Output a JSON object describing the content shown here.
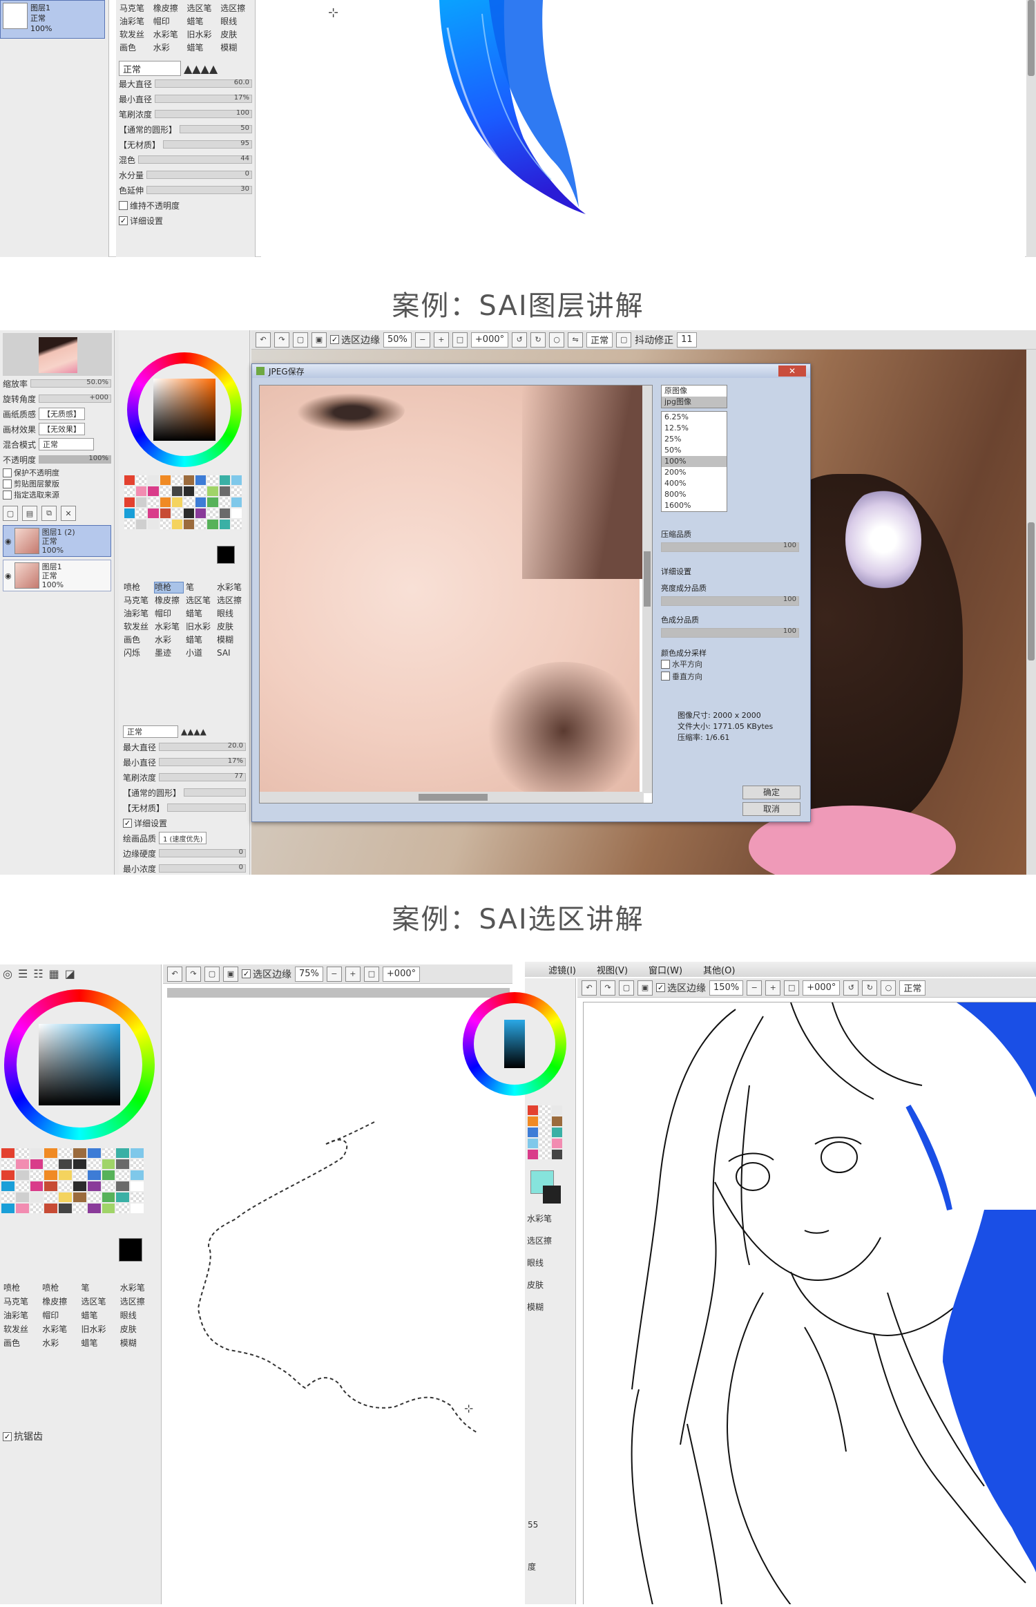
{
  "top_panel": {
    "layer_label": "图层1",
    "layer_mode": "正常",
    "layer_opacity": "100%",
    "tools": [
      [
        "马克笔",
        "橡皮擦",
        "选区笔",
        "选区擦"
      ],
      [
        "油彩笔",
        "帽印",
        "蜡笔",
        "眼线"
      ],
      [
        "软发丝",
        "水彩笔",
        "旧水彩",
        "皮肤"
      ],
      [
        "画色",
        "水彩",
        "蜡笔",
        "模糊"
      ]
    ],
    "blend_mode": "正常",
    "rows": [
      {
        "label": "最大直径",
        "value": "60.0"
      },
      {
        "label": "最小直径",
        "value": "17%"
      },
      {
        "label": "笔刷浓度",
        "value": "100"
      },
      {
        "label": "【通常的圆形】",
        "value": "50"
      },
      {
        "label": "【无材质】",
        "value": "95"
      },
      {
        "label": "混色",
        "value": "44"
      },
      {
        "label": "水分量",
        "value": "0"
      },
      {
        "label": "色延伸",
        "value": "30"
      }
    ],
    "keep_opacity": "维持不透明度",
    "detail_settings": "详细设置"
  },
  "caption1": "案例：SAI图层讲解",
  "caption2": "案例：SAI选区讲解",
  "mid": {
    "toolbar": {
      "selection_edge": "选区边缘",
      "zoom": "50%",
      "angle": "+000°",
      "mode": "正常",
      "stabilizer_label": "抖动修正",
      "stabilizer": "11"
    },
    "left_panel": {
      "rows": [
        {
          "label": "缩放率",
          "value": "50.0%"
        },
        {
          "label": "旋转角度",
          "value": "+000"
        }
      ],
      "paper_texture": "画纸质感",
      "paper_texture_value": "【无质感】",
      "paper_effect": "画材效果",
      "paper_effect_value": "【无效果】",
      "blend_label": "混合模式",
      "blend_value": "正常",
      "opacity_label": "不透明度",
      "opacity_value": "100%",
      "options": [
        "保护不透明度",
        "剪贴图层蒙版",
        "指定选取来源"
      ],
      "layers": [
        {
          "name": "图层1 (2)",
          "mode": "正常",
          "opacity": "100%"
        },
        {
          "name": "图层1",
          "mode": "正常",
          "opacity": "100%"
        }
      ]
    },
    "tool_panel": {
      "tools": [
        [
          "喷枪",
          "喷枪",
          "笔",
          "水彩笔"
        ],
        [
          "马克笔",
          "橡皮擦",
          "选区笔",
          "选区擦"
        ],
        [
          "油彩笔",
          "帽印",
          "蜡笔",
          "眼线"
        ],
        [
          "软发丝",
          "水彩笔",
          "旧水彩",
          "皮肤"
        ],
        [
          "画色",
          "水彩",
          "蜡笔",
          "模糊"
        ],
        [
          "闪烁",
          "墨迹",
          "小道",
          "SAI"
        ]
      ],
      "blend_mode": "正常",
      "rows": [
        {
          "label": "最大直径",
          "value": "20.0"
        },
        {
          "label": "最小直径",
          "value": "17%"
        },
        {
          "label": "笔刷浓度",
          "value": "77"
        },
        {
          "label": "【通常的圆形】",
          "value": ""
        },
        {
          "label": "【无材质】",
          "value": ""
        }
      ],
      "detail_settings": "详细设置",
      "quality_label": "绘画品质",
      "quality_value": "1 (速度优先)",
      "edge_hardness": "边缘硬度",
      "edge_value": "0",
      "min_density": "最小浓度",
      "min_density_value": "0"
    },
    "dialog": {
      "title": "JPEG保存",
      "view_options": [
        "原图像",
        "jpg图像"
      ],
      "zoom_levels": [
        "6.25%",
        "12.5%",
        "25%",
        "50%",
        "100%",
        "200%",
        "400%",
        "800%",
        "1600%"
      ],
      "selected_zoom": "100%",
      "quality_label": "压缩品质",
      "quality_value": "100",
      "detail_label": "详细设置",
      "luma_label": "亮度成分品质",
      "luma_value": "100",
      "chroma_label": "色成分品质",
      "chroma_value": "100",
      "subsample_label": "颜色成分采样",
      "horizontal": "水平方向",
      "vertical": "垂直方向",
      "size_label": "图像尺寸:",
      "size_value": "2000 x 2000",
      "file_label": "文件大小:",
      "file_value": "1771.05 KBytes",
      "ratio_label": "压缩率:",
      "ratio_value": "1/6.61",
      "ok": "确定",
      "cancel": "取消"
    }
  },
  "bottom_left": {
    "toolbar": {
      "selection_edge": "选区边缘",
      "zoom": "75%",
      "angle": "+000°"
    },
    "tools": [
      [
        "喷枪",
        "喷枪",
        "笔",
        "水彩笔"
      ],
      [
        "马克笔",
        "橡皮擦",
        "选区笔",
        "选区擦"
      ],
      [
        "油彩笔",
        "帽印",
        "蜡笔",
        "眼线"
      ],
      [
        "软发丝",
        "水彩笔",
        "旧水彩",
        "皮肤"
      ],
      [
        "画色",
        "水彩",
        "蜡笔",
        "模糊"
      ]
    ],
    "antialias": "抗锯齿"
  },
  "bottom_right": {
    "menu": [
      "滤镜(I)",
      "视图(V)",
      "窗口(W)",
      "其他(O)"
    ],
    "toolbar": {
      "selection_edge": "选区边缘",
      "zoom": "150%",
      "angle": "+000°",
      "mode": "正常"
    },
    "tools": [
      "水彩笔",
      "选区擦",
      "眼线",
      "皮肤",
      "模糊"
    ],
    "side_value": "55",
    "side_label": "度"
  },
  "colors": {
    "accent": "#1a4fe6",
    "selection": "#b5c8ec"
  }
}
